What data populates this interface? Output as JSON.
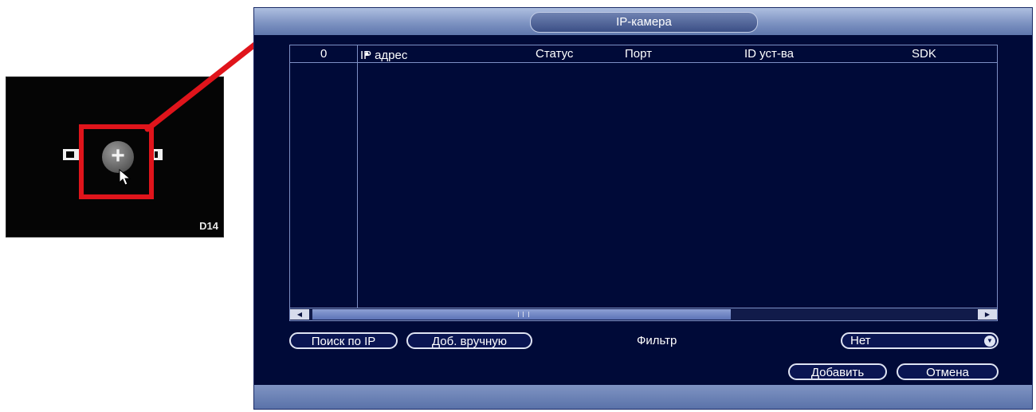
{
  "camera_tile": {
    "channel_label": "D14",
    "add_icon": "plus-icon",
    "pointer_icon": "cursor-icon"
  },
  "annotation": {
    "color": "#e0141b"
  },
  "dialog": {
    "title": "IP-камера",
    "table": {
      "columns": [
        "0",
        "IP адрес",
        "Статус",
        "Порт",
        "ID уст-ва",
        "SDK"
      ],
      "sorted_column": "IP адрес",
      "rows": []
    },
    "search_button": "Поиск по IP",
    "manual_add_button": "Доб. вручную",
    "filter_label": "Фильтр",
    "filter_value": "Нет",
    "add_button": "Добавить",
    "cancel_button": "Отмена"
  },
  "colors": {
    "dialog_bg": "#000a38",
    "bar_accent": "#7e93c2",
    "border": "#7d8fc4"
  }
}
